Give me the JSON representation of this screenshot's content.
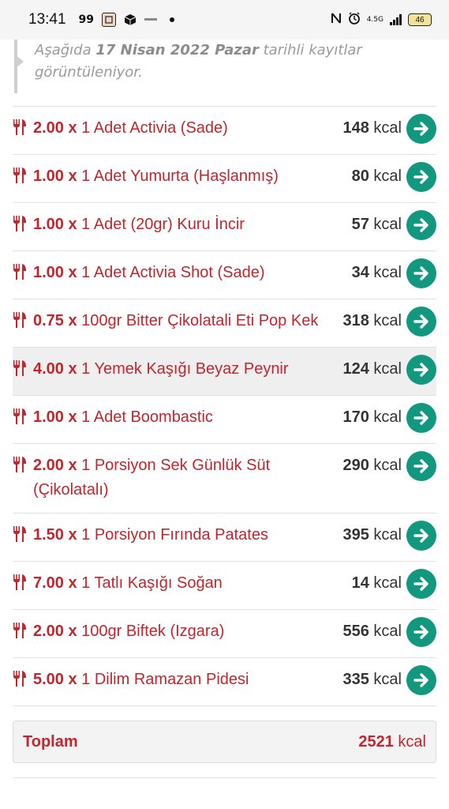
{
  "status_bar": {
    "time": "13:41",
    "icon_99": "99",
    "battery": "46",
    "network": "4.5G"
  },
  "notice": {
    "prefix": "Aşağıda ",
    "date": "17 Nisan 2022 Pazar",
    "suffix": " tarihli kayıtlar görüntüleniyor."
  },
  "entries": [
    {
      "qty": "2.00 x",
      "desc": " 1 Adet Activia (Sade)",
      "kcal": "148",
      "unit": " kcal"
    },
    {
      "qty": "1.00 x",
      "desc": " 1 Adet Yumurta (Haşlanmış)",
      "kcal": "80",
      "unit": " kcal"
    },
    {
      "qty": "1.00 x",
      "desc": " 1 Adet (20gr) Kuru İncir",
      "kcal": "57",
      "unit": " kcal"
    },
    {
      "qty": "1.00 x",
      "desc": " 1 Adet Activia Shot (Sade)",
      "kcal": "34",
      "unit": " kcal"
    },
    {
      "qty": "0.75 x",
      "desc": " 100gr Bitter Çikolatali Eti Pop Kek",
      "kcal": "318",
      "unit": " kcal"
    },
    {
      "qty": "4.00 x",
      "desc": " 1 Yemek Kaşığı Beyaz Peynir",
      "kcal": "124",
      "unit": " kcal"
    },
    {
      "qty": "1.00 x",
      "desc": " 1 Adet Boombastic",
      "kcal": "170",
      "unit": " kcal"
    },
    {
      "qty": "2.00 x",
      "desc": " 1 Porsiyon Sek Günlük Süt (Çikolatalı)",
      "kcal": "290",
      "unit": " kcal"
    },
    {
      "qty": "1.50 x",
      "desc": " 1 Porsiyon Fırında Patates",
      "kcal": "395",
      "unit": " kcal"
    },
    {
      "qty": "7.00 x",
      "desc": " 1 Tatlı Kaşığı Soğan",
      "kcal": "14",
      "unit": " kcal"
    },
    {
      "qty": "2.00 x",
      "desc": " 100gr Biftek (Izgara)",
      "kcal": "556",
      "unit": " kcal"
    },
    {
      "qty": "5.00 x",
      "desc": " 1 Dilim Ramazan Pidesi",
      "kcal": "335",
      "unit": " kcal"
    }
  ],
  "highlighted_index": 5,
  "total": {
    "label": "Toplam",
    "value": "2521",
    "unit": " kcal"
  },
  "colors": {
    "accent_red": "#c0262d",
    "button_teal": "#12987f"
  }
}
